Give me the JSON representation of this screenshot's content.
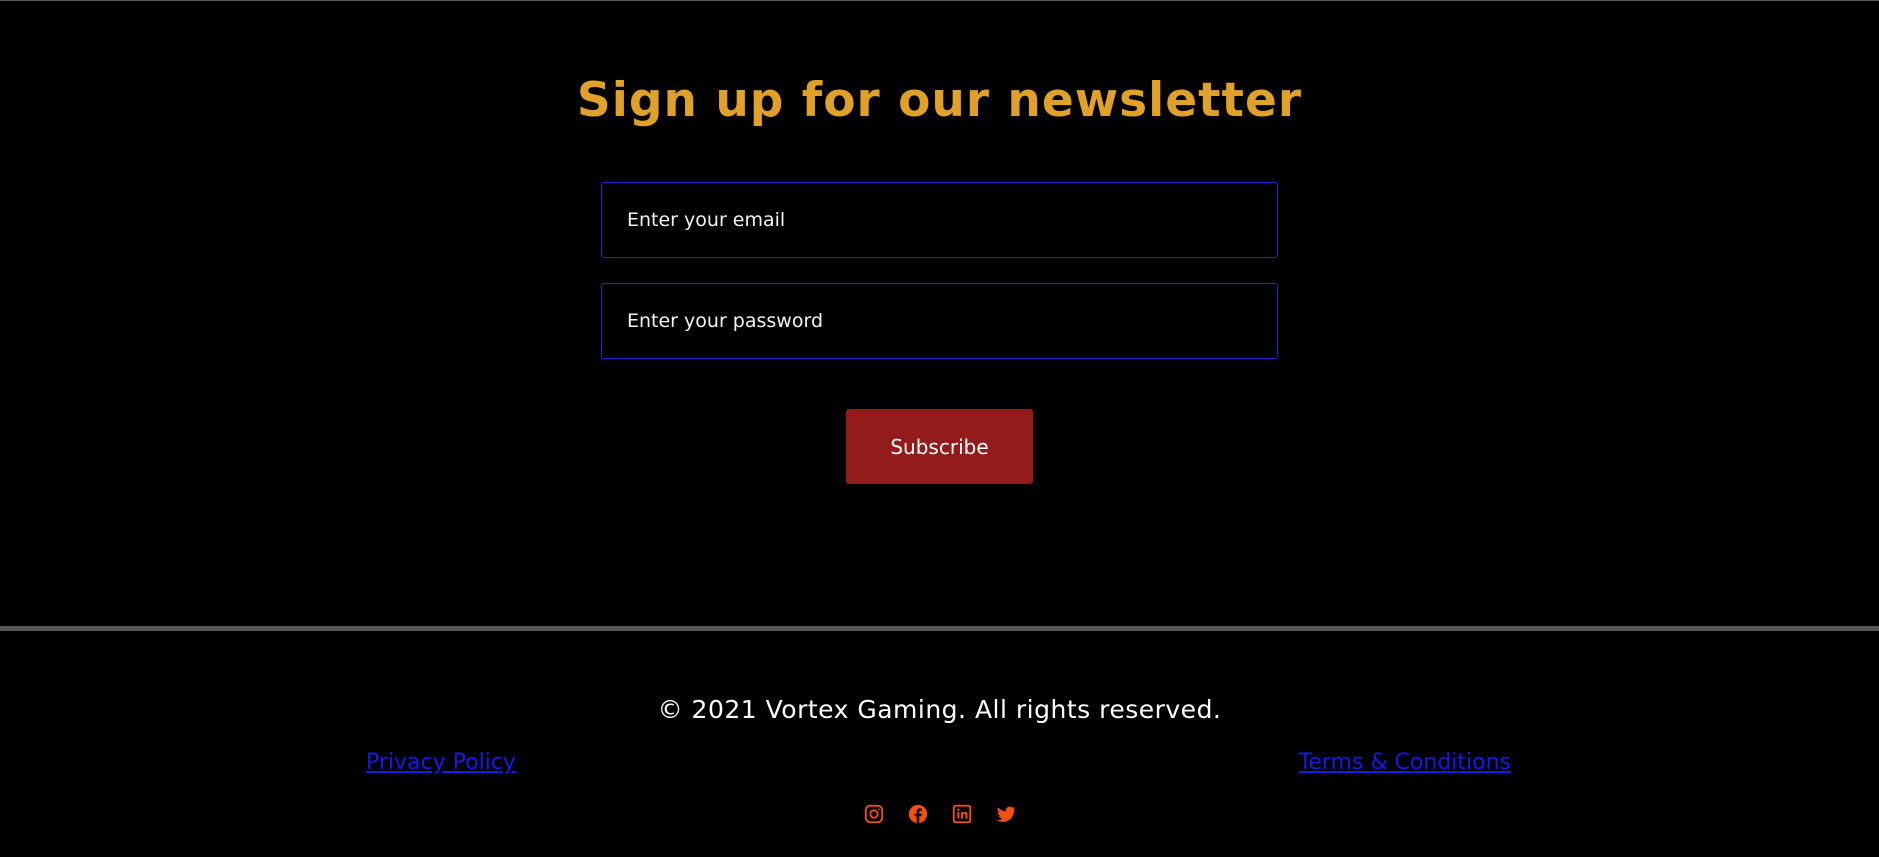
{
  "newsletter": {
    "title": "Sign up for our newsletter",
    "email_placeholder": "Enter your email",
    "password_placeholder": "Enter your password",
    "subscribe_label": "Subscribe"
  },
  "footer": {
    "copyright": "© 2021 Vortex Gaming. All rights reserved.",
    "privacy_label": "Privacy Policy",
    "terms_label": "Terms & Conditions",
    "socials": [
      "instagram-icon",
      "facebook-icon",
      "linkedin-icon",
      "twitter-icon"
    ]
  },
  "colors": {
    "background": "#000000",
    "title": "#dfa127",
    "field_border": "#2a22c9",
    "button": "#941b1b",
    "link": "#1a18e8",
    "social_icon": "#f2520f",
    "divider": "#595555"
  }
}
